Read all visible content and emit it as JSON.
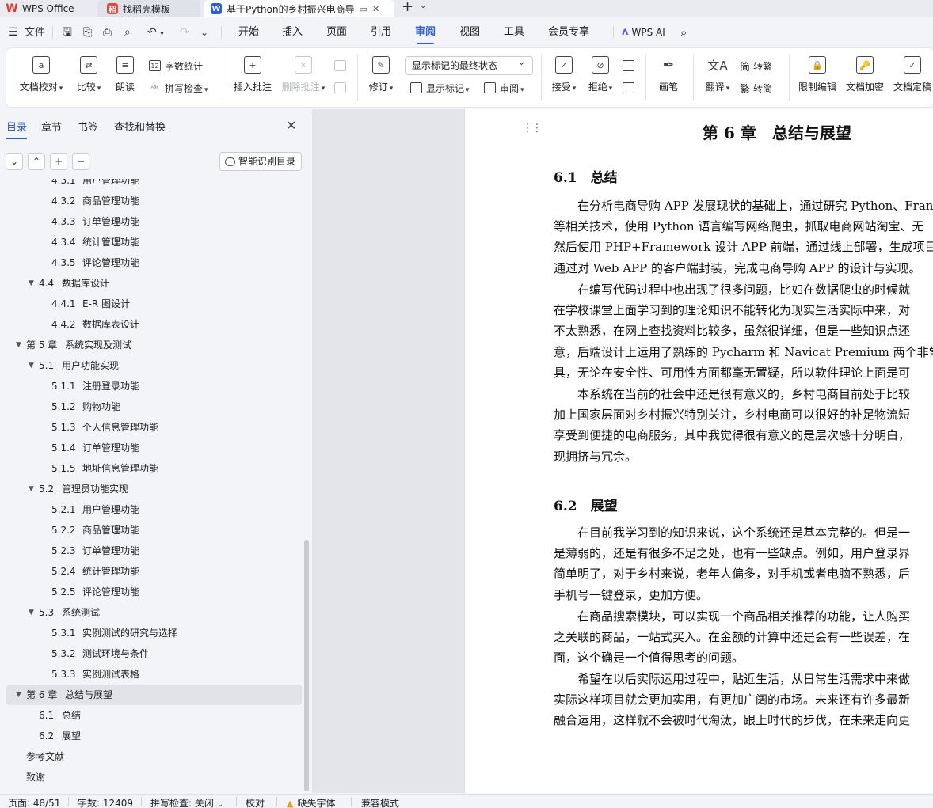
{
  "tabs": [
    {
      "label": "WPS Office",
      "icon": "wps-logo-icon"
    },
    {
      "label": "找稻壳模板",
      "icon": "docer-icon"
    },
    {
      "label": "基于Python的乡村振兴电商导",
      "icon": "word-doc-icon"
    }
  ],
  "menubar": {
    "file": "文件",
    "items": [
      "开始",
      "插入",
      "页面",
      "引用",
      "审阅",
      "视图",
      "工具",
      "会员专享"
    ],
    "active": "审阅",
    "wps_ai": "WPS AI"
  },
  "ribbon": {
    "doc_proof": "文档校对",
    "compare": "比较",
    "read_aloud": "朗读",
    "word_count": "字数统计",
    "spell_check": "拼写检查",
    "insert_comment": "插入批注",
    "delete_comment": "删除批注",
    "track_changes": "修订",
    "markup_mode": "显示标记的最终状态",
    "show_markup": "显示标记",
    "review": "审阅",
    "accept": "接受",
    "reject": "拒绝",
    "ink": "画笔",
    "translate": "翻译",
    "to_traditional": "转繁",
    "to_simplified": "转简",
    "restrict_edit": "限制编辑",
    "encrypt": "文档加密",
    "finalize": "文档定稿"
  },
  "nav": {
    "tabs": [
      "目录",
      "章节",
      "书签",
      "查找和替换"
    ],
    "active_tab": "目录",
    "smart_toc": "智能识别目录",
    "toc": [
      {
        "num": "4.3.1",
        "title": "用户管理功能",
        "level": 3
      },
      {
        "num": "4.3.2",
        "title": "商品管理功能",
        "level": 3
      },
      {
        "num": "4.3.3",
        "title": "订单管理功能",
        "level": 3
      },
      {
        "num": "4.3.4",
        "title": "统计管理功能",
        "level": 3
      },
      {
        "num": "4.3.5",
        "title": "评论管理功能",
        "level": 3
      },
      {
        "num": "4.4",
        "title": "数据库设计",
        "level": 2,
        "expanded": true
      },
      {
        "num": "4.4.1",
        "title": "E-R 图设计",
        "level": 3
      },
      {
        "num": "4.4.2",
        "title": "数据库表设计",
        "level": 3
      },
      {
        "num": "第 5 章",
        "title": "系统实现及测试",
        "level": 1,
        "expanded": true
      },
      {
        "num": "5.1",
        "title": "用户功能实现",
        "level": 2,
        "expanded": true
      },
      {
        "num": "5.1.1",
        "title": "注册登录功能",
        "level": 3
      },
      {
        "num": "5.1.2",
        "title": "购物功能",
        "level": 3
      },
      {
        "num": "5.1.3",
        "title": "个人信息管理功能",
        "level": 3
      },
      {
        "num": "5.1.4",
        "title": "订单管理功能",
        "level": 3
      },
      {
        "num": "5.1.5",
        "title": "地址信息管理功能",
        "level": 3
      },
      {
        "num": "5.2",
        "title": "管理员功能实现",
        "level": 2,
        "expanded": true
      },
      {
        "num": "5.2.1",
        "title": "用户管理功能",
        "level": 3
      },
      {
        "num": "5.2.2",
        "title": "商品管理功能",
        "level": 3
      },
      {
        "num": "5.2.3",
        "title": "订单管理功能",
        "level": 3
      },
      {
        "num": "5.2.4",
        "title": "统计管理功能",
        "level": 3
      },
      {
        "num": "5.2.5",
        "title": "评论管理功能",
        "level": 3
      },
      {
        "num": "5.3",
        "title": "系统测试",
        "level": 2,
        "expanded": true
      },
      {
        "num": "5.3.1",
        "title": "实例测试的研究与选择",
        "level": 3
      },
      {
        "num": "5.3.2",
        "title": "测试环境与条件",
        "level": 3
      },
      {
        "num": "5.3.3",
        "title": "实例测试表格",
        "level": 3
      },
      {
        "num": "第 6 章",
        "title": "总结与展望",
        "level": 1,
        "expanded": true,
        "selected": true
      },
      {
        "num": "6.1",
        "title": "总结",
        "level": 2
      },
      {
        "num": "6.2",
        "title": "展望",
        "level": 2
      },
      {
        "num": "",
        "title": "参考文献",
        "level": 1
      },
      {
        "num": "",
        "title": "致谢",
        "level": 1
      }
    ]
  },
  "document": {
    "chapter_title": "第 6 章　总结与展望",
    "sections": [
      {
        "heading": "6.1　总结",
        "paragraphs": [
          [
            "　　在分析电商导购 APP 发展现状的基础上，通过研究 Python、Fran",
            "等相关技术，使用 Python 语言编写网络爬虫，抓取电商网站淘宝、无",
            "然后使用 PHP+Framework 设计 APP 前端，通过线上部署，生成项目",
            "通过对 Web APP 的客户端封装，完成电商导购 APP 的设计与实现。"
          ],
          [
            "　　在编写代码过程中也出现了很多问题，比如在数据爬虫的时候就",
            "在学校课堂上面学习到的理论知识不能转化为现实生活实际中来，对",
            "不太熟悉，在网上查找资料比较多，虽然很详细，但是一些知识点还",
            "意，后端设计上运用了熟练的 Pycharm 和 Navicat Premium 两个非常成",
            "具，无论在安全性、可用性方面都毫无置疑，所以软件理论上面是可"
          ],
          [
            "　　本系统在当前的社会中还是很有意义的，乡村电商目前处于比较",
            "加上国家层面对乡村振兴特别关注，乡村电商可以很好的补足物流短",
            "享受到便捷的电商服务，其中我觉得很有意义的是层次感十分明白，",
            "现拥挤与冗余。"
          ]
        ]
      },
      {
        "heading": "6.2　展望",
        "paragraphs": [
          [
            "　　在目前我学习到的知识来说，这个系统还是基本完整的。但是一",
            "是薄弱的，还是有很多不足之处，也有一些缺点。例如，用户登录界",
            "简单明了，对于乡村来说，老年人偏多，对手机或者电脑不熟悉，后",
            "手机号一键登录，更加方便。"
          ],
          [
            "　　在商品搜索模块，可以实现一个商品相关推荐的功能，让人购买",
            "之关联的商品，一站式买入。在金额的计算中还是会有一些误差，在",
            "面，这个确是一个值得思考的问题。"
          ],
          [
            "　　希望在以后实际运用过程中，贴近生活，从日常生活需求中来做",
            "实际这样项目就会更加实用，有更加广阔的市场。未来还有许多最新",
            "融合运用，这样就不会被时代淘汰，跟上时代的步伐，在未来走向更"
          ]
        ]
      }
    ]
  },
  "status": {
    "page": "页面: 48/51",
    "word_count": "字数: 12409",
    "spell_check": "拼写检查: 关闭",
    "proofread": "校对",
    "missing_font": "缺失字体",
    "compat_mode": "兼容模式"
  }
}
